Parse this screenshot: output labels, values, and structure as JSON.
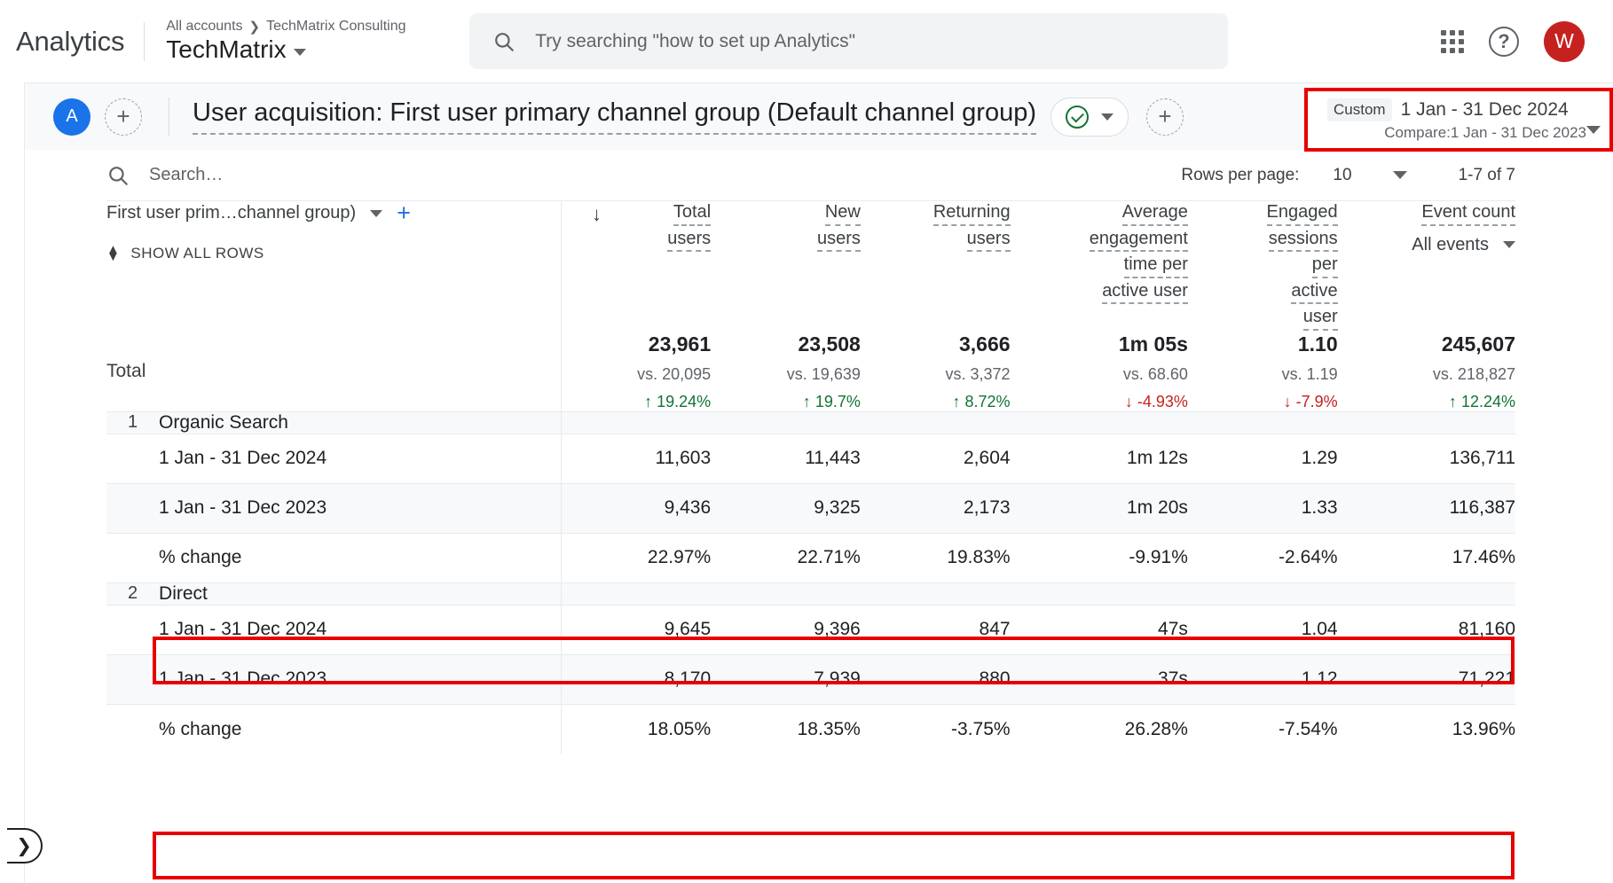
{
  "topbar": {
    "brand": "Analytics",
    "breadcrumb_root": "All accounts",
    "breadcrumb_sep": "❯",
    "breadcrumb_account": "TechMatrix Consulting",
    "property_name": "TechMatrix",
    "search_placeholder": "Try searching \"how to set up Analytics\"",
    "search_icon": "search-icon",
    "apps_icon": "apps-grid-icon",
    "help_icon": "help-icon",
    "avatar_letter": "W",
    "avatar_color": "#c5221f"
  },
  "report_header": {
    "badge_letter": "A",
    "badge_color": "#1a73e8",
    "add_comparison_label": "+",
    "title": "User acquisition: First user primary channel group (Default channel group)",
    "status_chip_icon": "check-circle-icon",
    "status_chip_caret": "chevron-down-icon",
    "add_chip_label": "+",
    "date_range": {
      "custom_label": "Custom",
      "primary": "1 Jan - 31 Dec 2024",
      "compare": "Compare:1 Jan - 31 Dec 2023",
      "highlight_color": "#e80000"
    }
  },
  "toolbar": {
    "search_placeholder": "Search…",
    "rows_per_page_label": "Rows per page:",
    "rows_per_page_value": "10",
    "page_range": "1-7 of 7"
  },
  "table": {
    "dimension_header": "First user prim…channel group)",
    "show_all_rows": "SHOW ALL ROWS",
    "sort_indicator": "↓",
    "columns": [
      {
        "line1": "Total",
        "line2": "users",
        "line3": "",
        "line4": "",
        "sub": ""
      },
      {
        "line1": "New",
        "line2": "users",
        "line3": "",
        "line4": "",
        "sub": ""
      },
      {
        "line1": "Returning",
        "line2": "users",
        "line3": "",
        "line4": "",
        "sub": ""
      },
      {
        "line1": "Average",
        "line2": "engagement",
        "line3": "time per",
        "line4": "active user",
        "sub": ""
      },
      {
        "line1": "Engaged",
        "line2": "sessions",
        "line3": "per",
        "line4": "active",
        "line5": "user",
        "sub": ""
      },
      {
        "line1": "Event count",
        "line2": "",
        "line3": "",
        "line4": "",
        "sub": "All events"
      }
    ],
    "total_row": {
      "label": "Total",
      "values": [
        "23,961",
        "23,508",
        "3,666",
        "1m 05s",
        "1.10",
        "245,607"
      ],
      "compare": [
        "vs. 20,095",
        "vs. 19,639",
        "vs. 3,372",
        "vs. 68.60",
        "vs. 1.19",
        "vs. 218,827"
      ],
      "deltas": [
        "19.24%",
        "19.7%",
        "8.72%",
        "-4.93%",
        "-7.9%",
        "12.24%"
      ],
      "dirs": [
        "up",
        "up",
        "up",
        "down",
        "down",
        "up"
      ]
    },
    "groups": [
      {
        "index": "1",
        "name": "Organic Search",
        "rows": [
          {
            "label": "1 Jan - 31 Dec 2024",
            "values": [
              "11,603",
              "11,443",
              "2,604",
              "1m 12s",
              "1.29",
              "136,711"
            ]
          },
          {
            "label": "1 Jan - 31 Dec 2023",
            "values": [
              "9,436",
              "9,325",
              "2,173",
              "1m 20s",
              "1.33",
              "116,387"
            ]
          },
          {
            "label": "% change",
            "values": [
              "22.97%",
              "22.71%",
              "19.83%",
              "-9.91%",
              "-2.64%",
              "17.46%"
            ],
            "highlighted": true
          }
        ]
      },
      {
        "index": "2",
        "name": "Direct",
        "rows": [
          {
            "label": "1 Jan - 31 Dec 2024",
            "values": [
              "9,645",
              "9,396",
              "847",
              "47s",
              "1.04",
              "81,160"
            ]
          },
          {
            "label": "1 Jan - 31 Dec 2023",
            "values": [
              "8,170",
              "7,939",
              "880",
              "37s",
              "1.12",
              "71,221"
            ]
          },
          {
            "label": "% change",
            "values": [
              "18.05%",
              "18.35%",
              "-3.75%",
              "26.28%",
              "-7.54%",
              "13.96%"
            ],
            "highlighted": true
          }
        ]
      }
    ]
  },
  "footer": {
    "expand_icon": "chevron-right-icon"
  }
}
